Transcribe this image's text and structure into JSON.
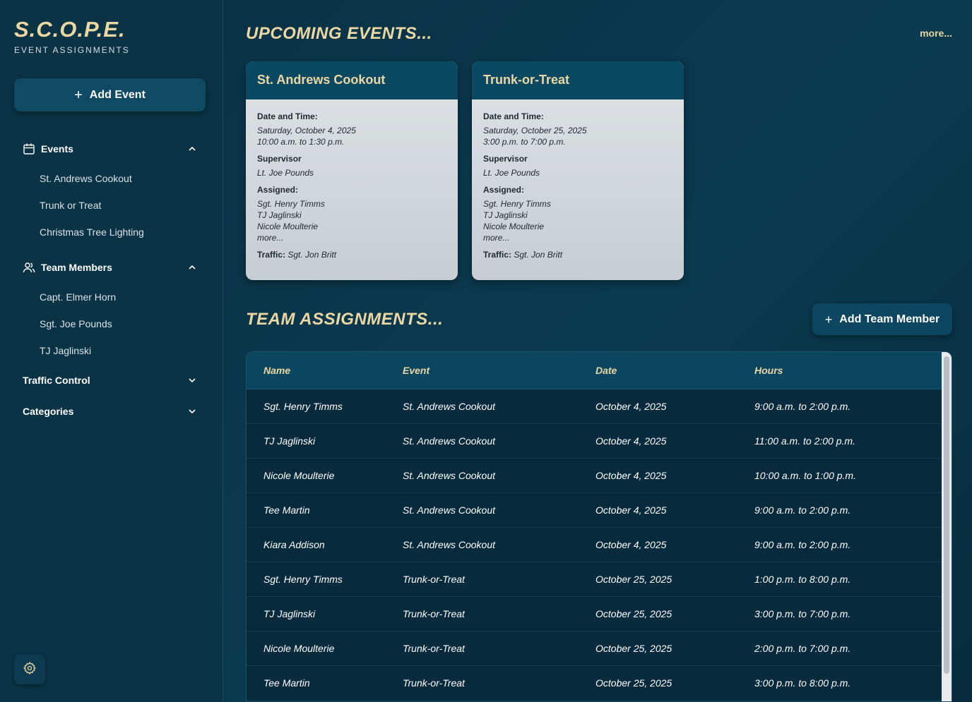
{
  "brand": {
    "title": "S.C.O.P.E.",
    "subtitle": "EVENT ASSIGNMENTS"
  },
  "sidebar": {
    "add_event_label": "Add Event",
    "events": {
      "label": "Events",
      "items": [
        "St. Andrews Cookout",
        "Trunk or Treat",
        "Christmas Tree Lighting"
      ]
    },
    "team_members": {
      "label": "Team Members",
      "items": [
        "Capt. Elmer Horn",
        "Sgt. Joe Pounds",
        "TJ Jaglinski"
      ]
    },
    "traffic_control": {
      "label": "Traffic Control"
    },
    "categories": {
      "label": "Categories"
    }
  },
  "upcoming": {
    "title": "UPCOMING EVENTS...",
    "more": "more...",
    "cards": [
      {
        "title": "St. Andrews Cookout",
        "date_label": "Date and Time:",
        "date": "Saturday, October 4, 2025",
        "time": "10:00 a.m. to 1:30 p.m.",
        "supervisor_label": "Supervisor",
        "supervisor": "Lt. Joe Pounds",
        "assigned_label": "Assigned:",
        "assigned": [
          "Sgt. Henry Timms",
          "TJ Jaglinski",
          "Nicole Moulterie",
          "more..."
        ],
        "traffic_label": "Traffic:",
        "traffic": "Sgt. Jon Britt"
      },
      {
        "title": "Trunk-or-Treat",
        "date_label": "Date and Time:",
        "date": "Saturday, October 25, 2025",
        "time": "3:00 p.m. to 7:00 p.m.",
        "supervisor_label": "Supervisor",
        "supervisor": "Lt. Joe Pounds",
        "assigned_label": "Assigned:",
        "assigned": [
          "Sgt. Henry Timms",
          "TJ Jaglinski",
          "Nicole Moulterie",
          "more..."
        ],
        "traffic_label": "Traffic:",
        "traffic": "Sgt. Jon Britt"
      }
    ]
  },
  "team": {
    "title": "TEAM ASSIGNMENTS...",
    "add_member_label": "Add Team Member",
    "columns": [
      "Name",
      "Event",
      "Date",
      "Hours"
    ],
    "rows": [
      [
        "Sgt. Henry Timms",
        "St. Andrews Cookout",
        "October 4, 2025",
        "9:00 a.m. to 2:00 p.m."
      ],
      [
        "TJ Jaglinski",
        "St. Andrews Cookout",
        "October 4, 2025",
        "11:00 a.m. to 2:00 p.m."
      ],
      [
        "Nicole Moulterie",
        "St. Andrews Cookout",
        "October 4, 2025",
        "10:00 a.m. to 1:00 p.m."
      ],
      [
        "Tee Martin",
        "St. Andrews Cookout",
        "October 4, 2025",
        "9:00 a.m. to 2:00 p.m."
      ],
      [
        "Kiara Addison",
        "St. Andrews Cookout",
        "October 4, 2025",
        "9:00 a.m. to 2:00 p.m."
      ],
      [
        "Sgt. Henry Timms",
        "Trunk-or-Treat",
        "October 25, 2025",
        "1:00 p.m. to 8:00 p.m."
      ],
      [
        "TJ Jaglinski",
        "Trunk-or-Treat",
        "October 25, 2025",
        "3:00 p.m. to 7:00 p.m."
      ],
      [
        "Nicole Moulterie",
        "Trunk-or-Treat",
        "October 25, 2025",
        "2:00 p.m. to 7:00 p.m."
      ],
      [
        "Tee Martin",
        "Trunk-or-Treat",
        "October 25, 2025",
        "3:00 p.m. to 8:00 p.m."
      ]
    ]
  },
  "icons": {
    "events": "calendar-icon",
    "team": "users-icon",
    "settings": "gear-icon",
    "add": "plus-icon"
  },
  "colors": {
    "accent": "#ead7a3",
    "sidebar": "#0a3346",
    "card_header": "#0b4862"
  }
}
